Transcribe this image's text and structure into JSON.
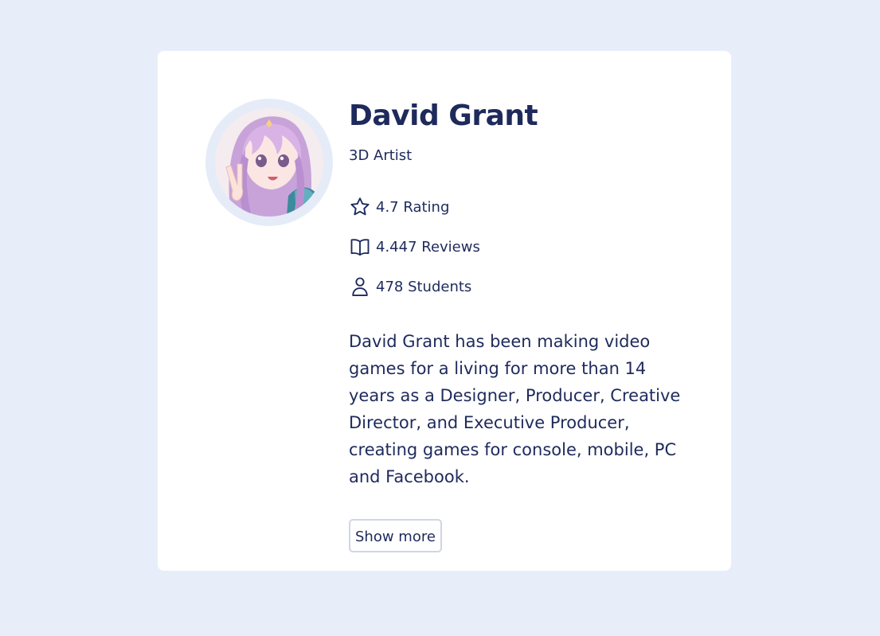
{
  "profile": {
    "name": "David Grant",
    "role": "3D Artist",
    "avatar_icon": "anime-girl-avatar"
  },
  "stats": {
    "rating": "4.7 Rating",
    "reviews": "4.447 Reviews",
    "students": "478 Students"
  },
  "bio": "David Grant has been making video games for a living for more than 14 years as a Designer, Producer, Creative Director, and Executive Producer, creating games for console, mobile, PC and Facebook.",
  "actions": {
    "show_more_label": "Show more"
  },
  "colors": {
    "page_background": "#e8eef9",
    "card_background": "#ffffff",
    "text_primary": "#1e2a5c",
    "avatar_ring": "#e5ecf8",
    "button_border": "#cfd6e4"
  }
}
